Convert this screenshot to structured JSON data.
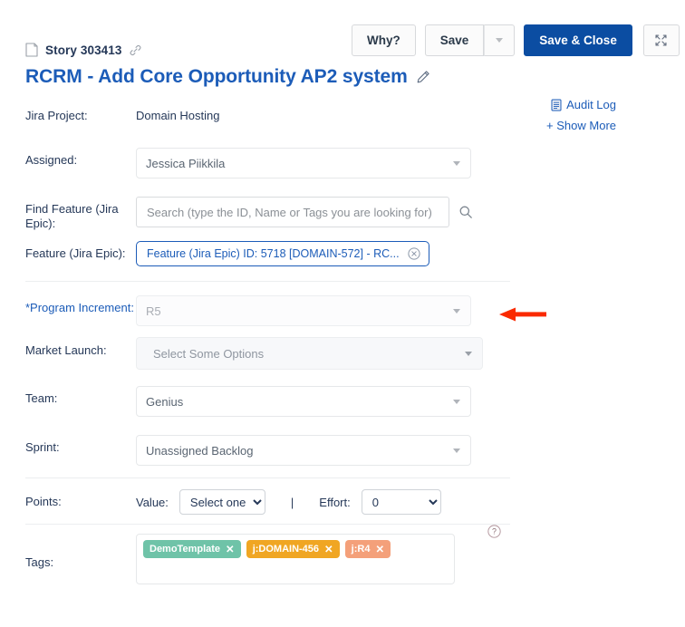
{
  "toolbar": {
    "why_label": "Why?",
    "save_label": "Save",
    "save_close_label": "Save & Close",
    "dropdown_icon": "caret-down-icon",
    "expand_icon": "expand-fullscreen-icon"
  },
  "header": {
    "story_icon": "document-icon",
    "story_label": "Story 303413",
    "link_icon": "link-icon",
    "title": "RCRM - Add Core Opportunity AP2 system",
    "edit_icon": "pencil-icon"
  },
  "side_links": {
    "audit_icon": "audit-log-icon",
    "audit_label": "Audit Log",
    "show_more_label": "+ Show More"
  },
  "form": {
    "jira_project": {
      "label": "Jira Project:",
      "value": "Domain Hosting"
    },
    "assigned": {
      "label": "Assigned:",
      "value": "Jessica Piikkila"
    },
    "find_feature": {
      "label": "Find Feature (Jira Epic):",
      "placeholder": "Search (type the ID, Name or Tags you are looking for)",
      "search_icon": "search-icon"
    },
    "feature": {
      "label": "Feature (Jira Epic):",
      "chip": "Feature (Jira Epic) ID: 5718 [DOMAIN-572] - RC...",
      "remove_icon": "remove-circle-icon"
    },
    "program_increment": {
      "label": "*Program Increment:",
      "value": "R5",
      "required": true,
      "disabled": true
    },
    "market_launch": {
      "label": "Market Launch:",
      "value": "Select Some Options"
    },
    "team": {
      "label": "Team:",
      "value": "Genius"
    },
    "sprint": {
      "label": "Sprint:",
      "value": "Unassigned Backlog"
    },
    "points": {
      "label": "Points:",
      "value_label": "Value:",
      "value_selected": "Select one",
      "separator": "|",
      "effort_label": "Effort:",
      "effort_selected": "0"
    },
    "tags": {
      "label": "Tags:",
      "help_icon": "help-circle-icon",
      "items": [
        {
          "text": "DemoTemplate",
          "color": "#6fc3a8",
          "remove": "✕"
        },
        {
          "text": "j:DOMAIN-456",
          "color": "#f0a623",
          "remove": "✕"
        },
        {
          "text": "j:R4",
          "color": "#f4a07a",
          "remove": "✕"
        }
      ]
    }
  },
  "annotation": {
    "arrow_icon": "red-left-arrow-annotation",
    "color": "#fa2a00",
    "points_at": "program_increment"
  },
  "colors": {
    "primary_button": "#0b4da2",
    "link": "#1c5cb8",
    "text": "#253858",
    "border": "#e6e8ea"
  }
}
